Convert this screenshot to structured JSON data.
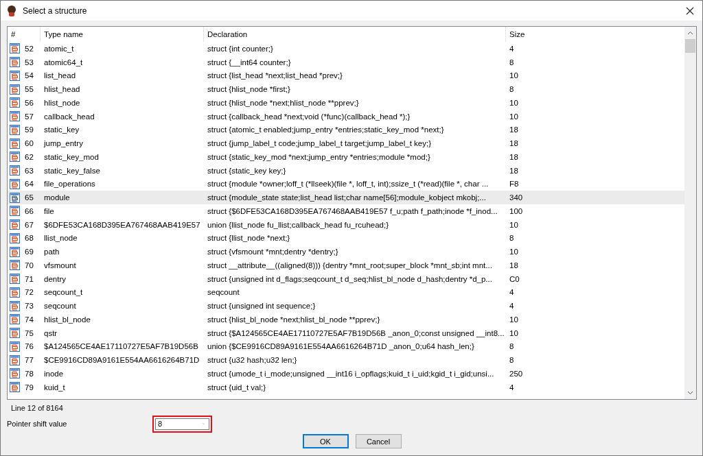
{
  "window": {
    "title": "Select a structure"
  },
  "table": {
    "columns": [
      "#",
      "Type name",
      "Declaration",
      "Size"
    ],
    "rows": [
      {
        "number": "52",
        "type_name": "atomic_t",
        "declaration": "struct {int counter;}",
        "size": "4",
        "selected": false
      },
      {
        "number": "53",
        "type_name": "atomic64_t",
        "declaration": "struct {__int64 counter;}",
        "size": "8",
        "selected": false
      },
      {
        "number": "54",
        "type_name": "list_head",
        "declaration": "struct {list_head *next;list_head *prev;}",
        "size": "10",
        "selected": false
      },
      {
        "number": "55",
        "type_name": "hlist_head",
        "declaration": "struct {hlist_node *first;}",
        "size": "8",
        "selected": false
      },
      {
        "number": "56",
        "type_name": "hlist_node",
        "declaration": "struct {hlist_node *next;hlist_node **pprev;}",
        "size": "10",
        "selected": false
      },
      {
        "number": "57",
        "type_name": "callback_head",
        "declaration": "struct {callback_head *next;void (*func)(callback_head *);}",
        "size": "10",
        "selected": false
      },
      {
        "number": "59",
        "type_name": "static_key",
        "declaration": "struct {atomic_t enabled;jump_entry *entries;static_key_mod *next;}",
        "size": "18",
        "selected": false
      },
      {
        "number": "60",
        "type_name": "jump_entry",
        "declaration": "struct {jump_label_t code;jump_label_t target;jump_label_t key;}",
        "size": "18",
        "selected": false
      },
      {
        "number": "62",
        "type_name": "static_key_mod",
        "declaration": "struct {static_key_mod *next;jump_entry *entries;module *mod;}",
        "size": "18",
        "selected": false
      },
      {
        "number": "63",
        "type_name": "static_key_false",
        "declaration": "struct {static_key key;}",
        "size": "18",
        "selected": false
      },
      {
        "number": "64",
        "type_name": "file_operations",
        "declaration": "struct {module *owner;loff_t (*llseek)(file *, loff_t, int);ssize_t (*read)(file *, char ...",
        "size": "F8",
        "selected": false
      },
      {
        "number": "65",
        "type_name": "module",
        "declaration": "struct {module_state state;list_head list;char name[56];module_kobject mkobj;...",
        "size": "340",
        "selected": true
      },
      {
        "number": "66",
        "type_name": "file",
        "declaration": "struct {$6DFE53CA168D395EA767468AAB419E57 f_u;path f_path;inode *f_inod...",
        "size": "100",
        "selected": false
      },
      {
        "number": "67",
        "type_name": "$6DFE53CA168D395EA767468AAB419E57",
        "declaration": "union {llist_node fu_llist;callback_head fu_rcuhead;}",
        "size": "10",
        "selected": false
      },
      {
        "number": "68",
        "type_name": "llist_node",
        "declaration": "struct {llist_node *next;}",
        "size": "8",
        "selected": false
      },
      {
        "number": "69",
        "type_name": "path",
        "declaration": "struct {vfsmount *mnt;dentry *dentry;}",
        "size": "10",
        "selected": false
      },
      {
        "number": "70",
        "type_name": "vfsmount",
        "declaration": "struct __attribute__((aligned(8))) {dentry *mnt_root;super_block *mnt_sb;int mnt...",
        "size": "18",
        "selected": false
      },
      {
        "number": "71",
        "type_name": "dentry",
        "declaration": "struct {unsigned int d_flags;seqcount_t d_seq;hlist_bl_node d_hash;dentry *d_p...",
        "size": "C0",
        "selected": false
      },
      {
        "number": "72",
        "type_name": "seqcount_t",
        "declaration": "seqcount",
        "size": "4",
        "selected": false
      },
      {
        "number": "73",
        "type_name": "seqcount",
        "declaration": "struct {unsigned int sequence;}",
        "size": "4",
        "selected": false
      },
      {
        "number": "74",
        "type_name": "hlist_bl_node",
        "declaration": "struct {hlist_bl_node *next;hlist_bl_node **pprev;}",
        "size": "10",
        "selected": false
      },
      {
        "number": "75",
        "type_name": "qstr",
        "declaration": "struct {$A124565CE4AE17110727E5AF7B19D56B _anon_0;const unsigned __int8...",
        "size": "10",
        "selected": false
      },
      {
        "number": "76",
        "type_name": "$A124565CE4AE17110727E5AF7B19D56B",
        "declaration": "union {$CE9916CD89A9161E554AA6616264B71D _anon_0;u64 hash_len;}",
        "size": "8",
        "selected": false
      },
      {
        "number": "77",
        "type_name": "$CE9916CD89A9161E554AA6616264B71D",
        "declaration": "struct {u32 hash;u32 len;}",
        "size": "8",
        "selected": false
      },
      {
        "number": "78",
        "type_name": "inode",
        "declaration": "struct {umode_t i_mode;unsigned __int16 i_opflags;kuid_t i_uid;kgid_t i_gid;unsi...",
        "size": "250",
        "selected": false
      },
      {
        "number": "79",
        "type_name": "kuid_t",
        "declaration": "struct {uid_t val;}",
        "size": "4",
        "selected": false
      }
    ]
  },
  "status": "Line 12 of 8164",
  "pointer_shift": {
    "label": "Pointer shift value",
    "value": "8",
    "highlighted": true
  },
  "buttons": [
    "OK",
    "Cancel"
  ]
}
